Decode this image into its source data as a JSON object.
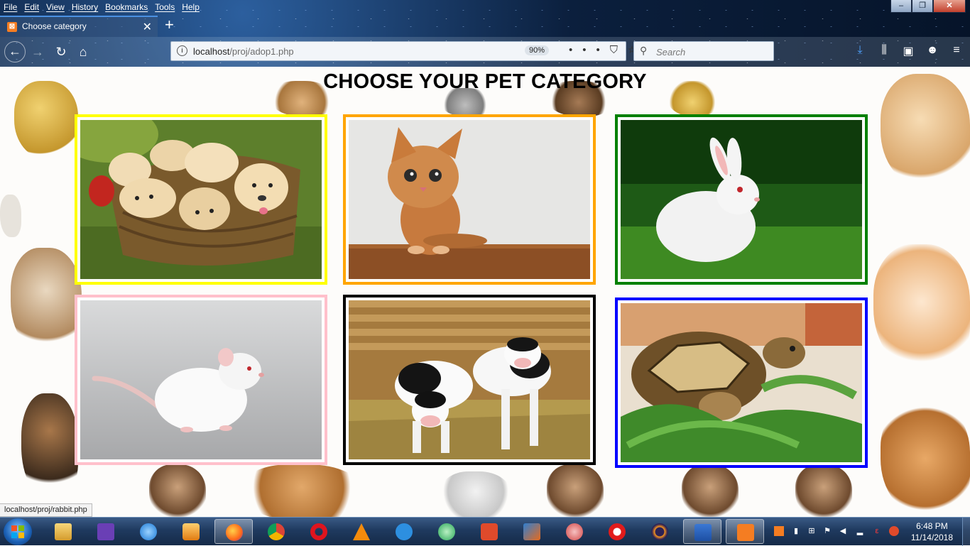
{
  "menu": [
    "File",
    "Edit",
    "View",
    "History",
    "Bookmarks",
    "Tools",
    "Help"
  ],
  "window_controls": {
    "minimize": "–",
    "maximize": "❐",
    "close": "✕"
  },
  "tab": {
    "title": "Choose category",
    "close": "✕",
    "new_tab": "+"
  },
  "nav": {
    "back": "←",
    "forward": "→",
    "reload": "↻",
    "home": "⌂"
  },
  "url": {
    "host": "localhost",
    "path": "/proj/adop1.php",
    "zoom": "90%"
  },
  "search": {
    "placeholder": "Search"
  },
  "page": {
    "title": "CHOOSE YOUR PET CATEGORY",
    "categories": [
      {
        "name": "puppies",
        "border": "#ffff00"
      },
      {
        "name": "kitten",
        "border": "#ffa500"
      },
      {
        "name": "rabbit",
        "border": "#008000"
      },
      {
        "name": "rat",
        "border": "#ffc0cb"
      },
      {
        "name": "calves",
        "border": "#000000"
      },
      {
        "name": "tortoise",
        "border": "#0000ff"
      }
    ]
  },
  "status_link": "localhost/proj/rabbit.php",
  "taskbar": {
    "apps": [
      "explorer",
      "visual-studio",
      "internet-explorer",
      "media-player",
      "firefox",
      "chrome",
      "opera",
      "vlc",
      "teamviewer",
      "atom",
      "publisher-p",
      "matlab",
      "paint-tool",
      "yandex",
      "eclipse",
      "word",
      "xampp"
    ],
    "clock_time": "6:48 PM",
    "clock_date": "11/14/2018"
  }
}
